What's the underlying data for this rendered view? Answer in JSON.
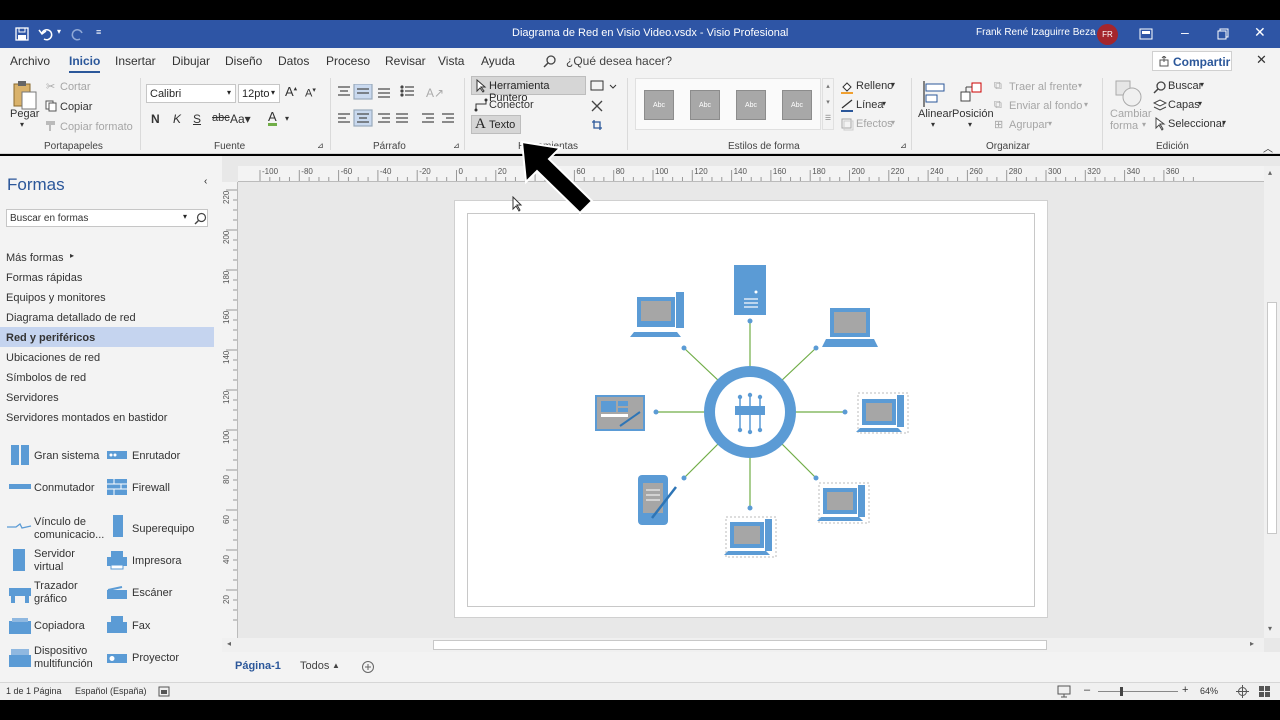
{
  "window": {
    "title": "Diagrama de Red en Visio Video.vsdx  -  Visio Profesional",
    "user_name": "Frank René Izaguirre Beza",
    "user_initials": "FR"
  },
  "menu": {
    "tabs": [
      "Archivo",
      "Inicio",
      "Insertar",
      "Dibujar",
      "Diseño",
      "Datos",
      "Proceso",
      "Revisar",
      "Vista",
      "Ayuda"
    ],
    "active": "Inicio",
    "tell_me": "¿Qué desea hacer?",
    "share": "Compartir"
  },
  "ribbon": {
    "clipboard": {
      "paste": "Pegar",
      "cut": "Cortar",
      "copy": "Copiar",
      "format_painter": "Copiar formato",
      "label": "Portapapeles"
    },
    "font": {
      "family": "Calibri",
      "size": "12pto",
      "label": "Fuente"
    },
    "paragraph": {
      "label": "Párrafo"
    },
    "tools": {
      "pointer": "Herramienta Puntero",
      "connector": "Conector",
      "text": "Texto",
      "label": "Herramientas"
    },
    "shape_styles": {
      "sample": "Abc",
      "fill": "Relleno",
      "line": "Línea",
      "effects": "Efectos",
      "label": "Estilos de forma"
    },
    "arrange": {
      "align": "Alinear",
      "position": "Posición",
      "bring_front": "Traer al frente",
      "send_back": "Enviar al fondo",
      "group": "Agrupar",
      "label": "Organizar"
    },
    "editing": {
      "change_shape": "Cambiar forma",
      "find": "Buscar",
      "layers": "Capas",
      "select": "Seleccionar",
      "label": "Edición"
    }
  },
  "shapes": {
    "title": "Formas",
    "search_placeholder": "Buscar en formas",
    "nav": [
      "Más formas",
      "Formas rápidas",
      "Equipos y monitores",
      "Diagrama detallado de red",
      "Red y periféricos",
      "Ubicaciones de red",
      "Símbolos de red",
      "Servidores",
      "Servidores montados en bastidor"
    ],
    "selected": "Red y periféricos",
    "stencils": [
      {
        "label": "Gran sistema",
        "icon": "mainframe-icon"
      },
      {
        "label": "Enrutador",
        "icon": "router-icon"
      },
      {
        "label": "Conmutador",
        "icon": "switch-icon"
      },
      {
        "label": "Firewall",
        "icon": "firewall-icon"
      },
      {
        "label": "Vínculo de comunicacio...",
        "icon": "comm-link-icon"
      },
      {
        "label": "Superequipo",
        "icon": "supercomputer-icon"
      },
      {
        "label": "Servidor virtual",
        "icon": "virtual-server-icon"
      },
      {
        "label": "Impresora",
        "icon": "printer-icon"
      },
      {
        "label": "Trazador gráfico",
        "icon": "plotter-icon"
      },
      {
        "label": "Escáner",
        "icon": "scanner-icon"
      },
      {
        "label": "Copiadora",
        "icon": "copier-icon"
      },
      {
        "label": "Fax",
        "icon": "fax-icon"
      },
      {
        "label": "Dispositivo multifunción",
        "icon": "multifunction-icon"
      },
      {
        "label": "Proyector",
        "icon": "projector-icon"
      }
    ]
  },
  "ruler": {
    "h_ticks": [
      "-100",
      "-80",
      "-60",
      "-40",
      "-20",
      "0",
      "20",
      "40",
      "60",
      "80",
      "100",
      "120",
      "140",
      "160",
      "180",
      "200",
      "220",
      "240",
      "260",
      "280",
      "300",
      "320",
      "340",
      "360"
    ],
    "v_ticks": [
      "220",
      "200",
      "180",
      "160",
      "140",
      "120",
      "100",
      "80",
      "60",
      "40",
      "20"
    ]
  },
  "tabs": {
    "page": "Página-1",
    "all": "Todos"
  },
  "status": {
    "page": "1 de 1 Página",
    "language": "Español (España)",
    "zoom": "64%"
  },
  "colors": {
    "title_bar": "#2e55a5",
    "accent": "#2b579a",
    "device_blue": "#5b9bd5",
    "connector_green": "#70ad47"
  }
}
